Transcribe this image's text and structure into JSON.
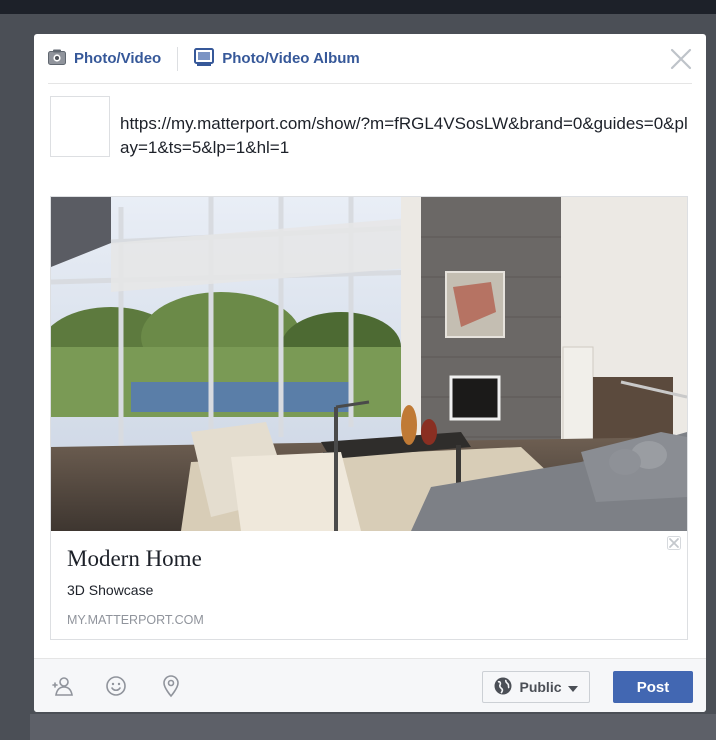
{
  "tabs": [
    {
      "label": "Photo/Video",
      "icon": "camera-icon"
    },
    {
      "label": "Photo/Video Album",
      "icon": "photo-album-icon"
    }
  ],
  "composer": {
    "url_text": "https://my.matterport.com/show/?m=fRGL4VSosLW&brand=0&guides=0&play=1&ts=5&lp=1&hl=1"
  },
  "link_preview": {
    "title": "Modern Home",
    "description": "3D Showcase",
    "domain": "MY.MATTERPORT.COM"
  },
  "footer": {
    "icons": [
      "tag-friends-icon",
      "feeling-icon",
      "location-icon"
    ],
    "privacy_label": "Public",
    "post_label": "Post"
  },
  "colors": {
    "link_blue": "#365899",
    "post_button": "#4267b2",
    "overlay": "#4b4f56"
  }
}
